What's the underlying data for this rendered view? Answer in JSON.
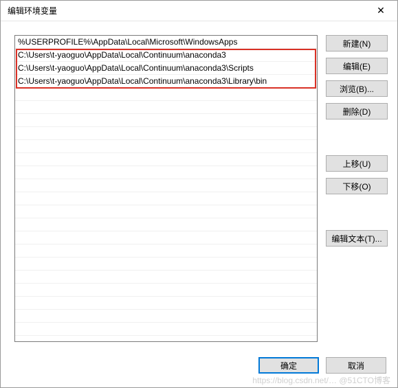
{
  "window": {
    "title": "编辑环境变量",
    "close_glyph": "✕"
  },
  "paths": [
    "%USERPROFILE%\\AppData\\Local\\Microsoft\\WindowsApps",
    "C:\\Users\\t-yaoguo\\AppData\\Local\\Continuum\\anaconda3",
    "C:\\Users\\t-yaoguo\\AppData\\Local\\Continuum\\anaconda3\\Scripts",
    "C:\\Users\\t-yaoguo\\AppData\\Local\\Continuum\\anaconda3\\Library\\bin"
  ],
  "buttons": {
    "new": "新建(N)",
    "edit": "编辑(E)",
    "browse": "浏览(B)...",
    "delete": "删除(D)",
    "move_up": "上移(U)",
    "move_down": "下移(O)",
    "edit_text": "编辑文本(T)...",
    "ok": "确定",
    "cancel": "取消"
  },
  "watermark": "https://blog.csdn.net/…  @51CTO博客"
}
